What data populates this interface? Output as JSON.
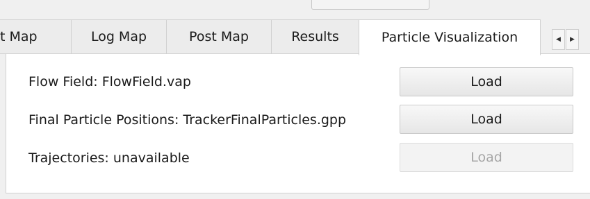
{
  "tabs": [
    {
      "label": "t Map",
      "active": false
    },
    {
      "label": "Log Map",
      "active": false
    },
    {
      "label": "Post Map",
      "active": false
    },
    {
      "label": "Results",
      "active": false
    },
    {
      "label": "Particle Visualization",
      "active": true
    }
  ],
  "tab_scroll": {
    "left_icon": "triangle-left",
    "right_icon": "triangle-right"
  },
  "rows": [
    {
      "label": "Flow Field: FlowField.vap",
      "button_label": "Load",
      "enabled": true
    },
    {
      "label": "Final Particle Positions: TrackerFinalParticles.gpp",
      "button_label": "Load",
      "enabled": true
    },
    {
      "label": "Trajectories: unavailable",
      "button_label": "Load",
      "enabled": false
    }
  ]
}
